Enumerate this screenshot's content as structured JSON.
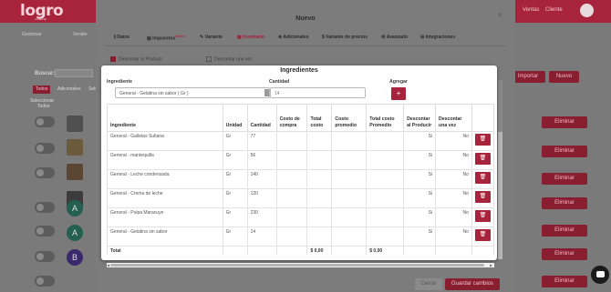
{
  "header": {
    "logo": "logro",
    "logo_sub": "comercial",
    "user_name": "Cliente",
    "right_label": "Ventas"
  },
  "background": {
    "tabs": [
      "Gestionar",
      "Vender"
    ],
    "search_label": "Buscar:",
    "filters": [
      "Todos",
      "Adicionales",
      "Sele"
    ],
    "select_all": [
      "Seleccionar",
      "Todos"
    ],
    "thumb_letters": [
      "A",
      "A",
      "B"
    ],
    "import_button": "Importar",
    "new_button": "Nuevo",
    "delete_button": "Eliminar"
  },
  "nuevo_modal": {
    "title": "Nuevo",
    "tabs": [
      {
        "label": "Datos",
        "icon": "info-icon",
        "badge": ""
      },
      {
        "label": "Impuestos",
        "icon": "tax-icon",
        "badge": "Nuevo"
      },
      {
        "label": "Variante",
        "icon": "tag-icon",
        "badge": ""
      },
      {
        "label": "Inventario",
        "icon": "inventory-icon",
        "badge": ""
      },
      {
        "label": "Adicionales",
        "icon": "plus-circle-icon",
        "badge": ""
      },
      {
        "label": "Variante de precios",
        "icon": "dollar-icon",
        "badge": ""
      },
      {
        "label": "Avanzado",
        "icon": "gear-icon",
        "badge": ""
      },
      {
        "label": "Integraciones",
        "icon": "grid-icon",
        "badge": ""
      }
    ],
    "checkbox_descontar_producto": "Descontar al Producir",
    "checkbox_descontar_vez": "Descontar una vez",
    "close_button": "Cerrar",
    "save_button": "Guardar cambios"
  },
  "ingredientes": {
    "title": "Ingredientes",
    "label_ingrediente": "Ingrediente",
    "label_cantidad": "Cantidad",
    "label_agregar": "Agregar",
    "selected_ingredient": "General - Gelatina sin sabor ( Gr )",
    "quantity_value": "14",
    "add_button": "+",
    "columns": [
      "Ingrediente",
      "Unidad",
      "Cantidad",
      "Costo de compra",
      "Total costo",
      "Costo promedio",
      "Total costo Promedio",
      "Descontar al Producir",
      "Descontar una vez",
      ""
    ],
    "rows": [
      {
        "ingrediente": "General - Galletas Sultana",
        "unidad": "Gr",
        "cantidad": "77",
        "producir": "Si",
        "vez": "No"
      },
      {
        "ingrediente": "General - mantequilla",
        "unidad": "Gr",
        "cantidad": "56",
        "producir": "Si",
        "vez": "No"
      },
      {
        "ingrediente": "General - Leche condensada",
        "unidad": "Gr",
        "cantidad": "140",
        "producir": "Si",
        "vez": "No"
      },
      {
        "ingrediente": "General - Crema de leche",
        "unidad": "Gr",
        "cantidad": "120",
        "producir": "Si",
        "vez": "No"
      },
      {
        "ingrediente": "General - Pulpa Maracuye",
        "unidad": "Gr",
        "cantidad": "230",
        "producir": "Si",
        "vez": "No"
      },
      {
        "ingrediente": "General - Gelatina sin sabor",
        "unidad": "Gr",
        "cantidad": "14",
        "producir": "Si",
        "vez": "No"
      }
    ],
    "total_label": "Total",
    "total_costo": "$ 0,00",
    "total_costo_promedio": "$ 0,00",
    "delete_icon": "trash-icon"
  }
}
